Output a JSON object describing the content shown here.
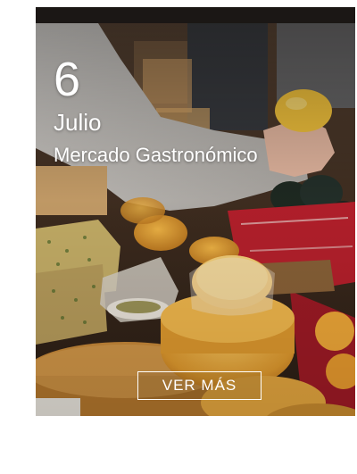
{
  "event": {
    "day": "6",
    "month": "Julio",
    "title": "Mercado Gastronómico",
    "cta_label": "VER MÁS"
  },
  "colors": {
    "text": "#ffffff",
    "topbar": "#1b1715",
    "cheese": "#e3a53e",
    "tablecloth": "#b8202c"
  }
}
